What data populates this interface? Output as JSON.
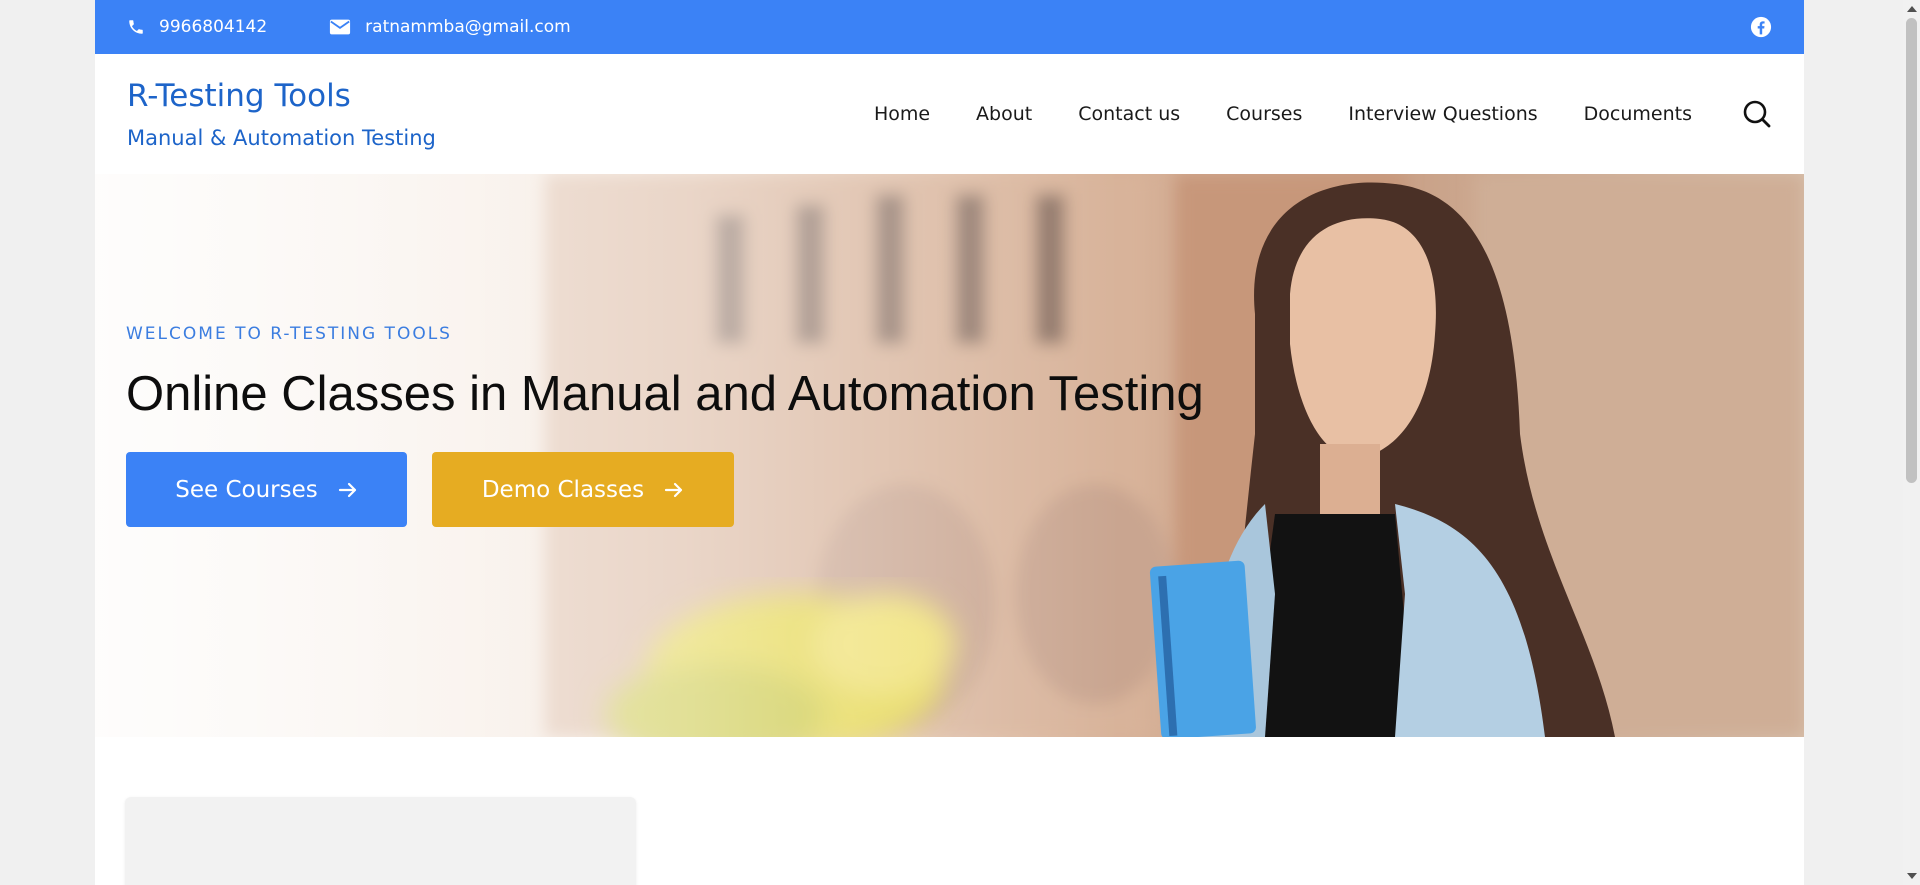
{
  "topbar": {
    "phone": "9966804142",
    "email": "ratnammba@gmail.com",
    "social_icon": "facebook-icon"
  },
  "brand": {
    "title": "R-Testing Tools",
    "tagline": "Manual & Automation Testing"
  },
  "nav": {
    "items": [
      "Home",
      "About",
      "Contact us",
      "Courses",
      "Interview Questions",
      "Documents"
    ],
    "search_icon": "search-icon"
  },
  "hero": {
    "eyebrow": "WELCOME TO R-TESTING TOOLS",
    "headline": "Online Classes in Manual and Automation Testing",
    "primary_button": "See Courses",
    "secondary_button": "Demo Classes"
  },
  "colors": {
    "accent": "#3b82f6",
    "brand_text": "#1d64c9",
    "secondary_button": "#e6ac22"
  }
}
